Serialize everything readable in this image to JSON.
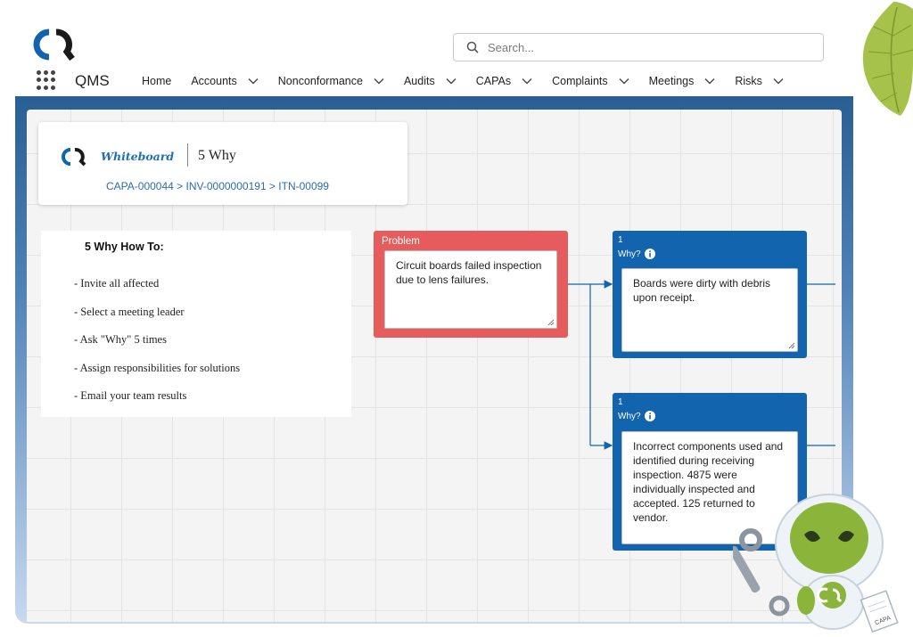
{
  "search": {
    "placeholder": "Search..."
  },
  "app": {
    "name": "QMS"
  },
  "nav": [
    {
      "label": "Home",
      "dropdown": false
    },
    {
      "label": "Accounts",
      "dropdown": true
    },
    {
      "label": "Nonconformance",
      "dropdown": true
    },
    {
      "label": "Audits",
      "dropdown": true
    },
    {
      "label": "CAPAs",
      "dropdown": true
    },
    {
      "label": "Complaints",
      "dropdown": true
    },
    {
      "label": "Meetings",
      "dropdown": true
    },
    {
      "label": "Risks",
      "dropdown": true
    }
  ],
  "title_card": {
    "brand_label": "Whiteboard",
    "title": "5 Why",
    "breadcrumb": [
      "CAPA-000044",
      "INV-0000000191",
      "ITN-00099"
    ],
    "separator": " > "
  },
  "howto": {
    "title": "5 Why How To:",
    "items": [
      "- Invite all affected",
      "- Select a meeting leader",
      "- Ask \"Why\" 5 times",
      "- Assign responsibilities for solutions",
      "- Email your team results"
    ]
  },
  "problem": {
    "header": "Problem",
    "text": "Circuit boards failed inspection due to lens failures."
  },
  "whys": [
    {
      "number": "1",
      "label": "Why?",
      "text": "Boards were dirty with debris upon receipt."
    },
    {
      "number": "1",
      "label": "Why?",
      "text": "Incorrect components used and identified during receiving inspection. 4875 were individually inspected and accepted. 125 returned to vendor."
    }
  ],
  "mascot": {
    "badge": "CAPA"
  },
  "colors": {
    "problem": "#e65b5b",
    "why": "#1264ae",
    "link": "#2a6db0",
    "frame": "#2a5f94"
  }
}
